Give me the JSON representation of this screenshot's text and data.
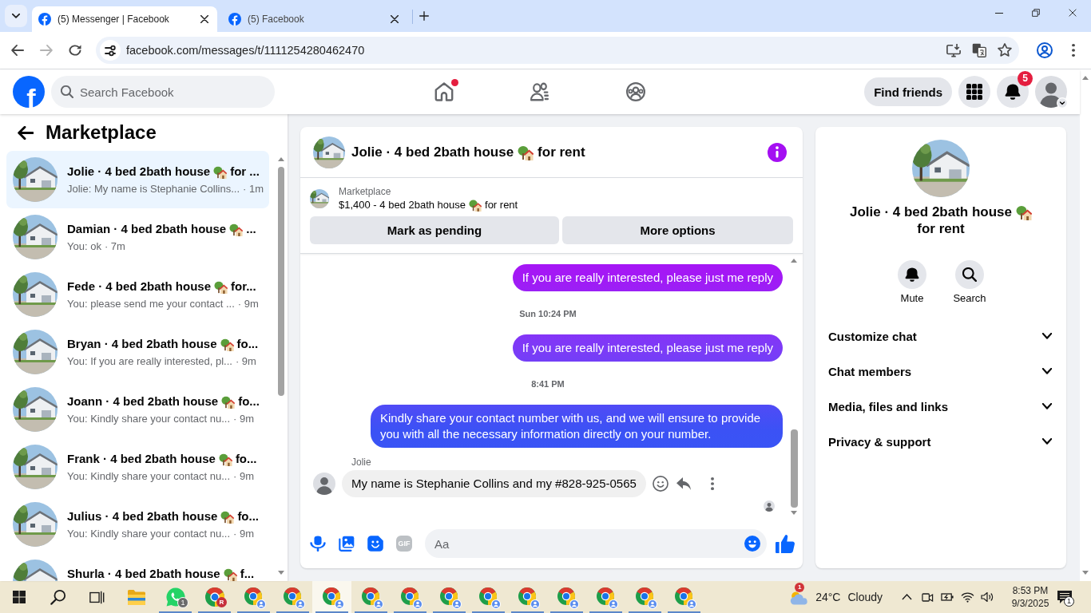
{
  "browser": {
    "tabs": [
      {
        "title": "(5) Messenger | Facebook",
        "selected": true
      },
      {
        "title": "(5) Facebook",
        "selected": false
      }
    ],
    "nav_buttons": [
      {
        "kind": "back",
        "disabled": false
      },
      {
        "kind": "forward",
        "disabled": true
      },
      {
        "kind": "reload",
        "disabled": false
      }
    ],
    "address": "facebook.com/messages/t/1111254280462470"
  },
  "header": {
    "logo": "f",
    "search": {
      "placeholder": "Search Facebook"
    },
    "nav": [
      {
        "kind": "home",
        "selected": false,
        "dot": true
      },
      {
        "kind": "friends",
        "selected": false,
        "dot": false
      },
      {
        "kind": "groups",
        "selected": false,
        "dot": false
      }
    ],
    "find_friends": "Find friends",
    "notifications_badge": "5"
  },
  "sidebar": {
    "title": "Marketplace",
    "conversations": [
      {
        "name": "Jolie · 4 bed 2bath house",
        "name_end": "for ...",
        "preview": "Jolie: My name is Stephanie Collins...",
        "time": "· 1m",
        "selected": true
      },
      {
        "name": "Damian · 4 bed 2bath house",
        "name_end": "...",
        "preview": "You: ok",
        "time": "· 7m",
        "selected": false
      },
      {
        "name": "Fede · 4 bed 2bath house",
        "name_end": "for...",
        "preview": "You: please send me your contact ...",
        "time": "· 9m",
        "selected": false
      },
      {
        "name": "Bryan · 4 bed 2bath house",
        "name_end": "fo...",
        "preview": "You: If you are really interested, pl...",
        "time": "· 9m",
        "selected": false
      },
      {
        "name": "Joann · 4 bed 2bath house",
        "name_end": "fo...",
        "preview": "You: Kindly share your contact nu...",
        "time": "· 9m",
        "selected": false
      },
      {
        "name": "Frank · 4 bed 2bath house",
        "name_end": "fo...",
        "preview": "You: Kindly share your contact nu...",
        "time": "· 9m",
        "selected": false
      },
      {
        "name": "Julius · 4 bed 2bath house",
        "name_end": "fo...",
        "preview": "You: Kindly share your contact nu...",
        "time": "· 9m",
        "selected": false
      },
      {
        "name": "Shurla · 4 bed 2bath house",
        "name_end": "f...",
        "selected": false
      }
    ]
  },
  "chat": {
    "title": "Jolie · 4 bed 2bath house",
    "title_end": "for rent",
    "listing": {
      "label": "Marketplace",
      "title": "$1,400 - 4 bed 2bath house",
      "title_end": "for rent"
    },
    "actions": [
      "Mark as pending",
      "More options"
    ],
    "messages": [
      {
        "kind": "outgoing",
        "text": "If you are really interested, please just me reply"
      },
      {
        "kind": "time",
        "text": "Sun 10:24 PM"
      },
      {
        "kind": "outgoing",
        "text": "If you are really interested, please just me reply"
      },
      {
        "kind": "time",
        "text": "8:41 PM"
      },
      {
        "kind": "outgoing",
        "text": "Kindly share your contact number with us, and we will ensure to provide you with all the necessary information directly on your number."
      },
      {
        "kind": "incoming",
        "sender": "Jolie",
        "text": "My name is Stephanie Collins and my #828-925-0565"
      }
    ],
    "composer": {
      "gif": "GIF",
      "placeholder": "Aa"
    }
  },
  "details": {
    "title": "Jolie · 4 bed 2bath house",
    "title_end": "for rent",
    "actions": [
      {
        "kind": "mute",
        "label": "Mute"
      },
      {
        "kind": "search",
        "label": "Search"
      }
    ],
    "sections": [
      {
        "label": "Customize chat",
        "expanded": false
      },
      {
        "label": "Chat members",
        "expanded": false
      },
      {
        "label": "Media, files and links",
        "expanded": false
      },
      {
        "label": "Privacy & support",
        "expanded": false
      }
    ]
  },
  "taskbar": {
    "apps": [
      {
        "kind": "explorer",
        "selected": false,
        "running": false
      },
      {
        "kind": "whatsapp",
        "badge": "1",
        "selected": false,
        "running": true
      },
      {
        "kind": "chrome",
        "avatar_letter": "R",
        "selected": false,
        "running": true
      },
      {
        "kind": "chrome",
        "selected": false,
        "running": true
      },
      {
        "kind": "chrome",
        "selected": false,
        "running": true
      },
      {
        "kind": "chrome",
        "selected": true,
        "running": true
      },
      {
        "kind": "chrome",
        "selected": false,
        "running": true
      },
      {
        "kind": "chrome",
        "selected": false,
        "running": true
      },
      {
        "kind": "chrome",
        "selected": false,
        "running": true
      },
      {
        "kind": "chrome",
        "selected": false,
        "running": true
      },
      {
        "kind": "chrome",
        "selected": false,
        "running": true
      },
      {
        "kind": "chrome",
        "selected": false,
        "running": true
      },
      {
        "kind": "chrome",
        "selected": false,
        "running": true
      },
      {
        "kind": "chrome",
        "selected": false,
        "running": true
      },
      {
        "kind": "chrome",
        "selected": false,
        "running": true
      }
    ],
    "weather": {
      "badge": "1",
      "temperature": "24°C",
      "condition": "Cloudy"
    },
    "time": "8:53 PM",
    "date": "9/3/2025",
    "notifications_badge": "1"
  }
}
